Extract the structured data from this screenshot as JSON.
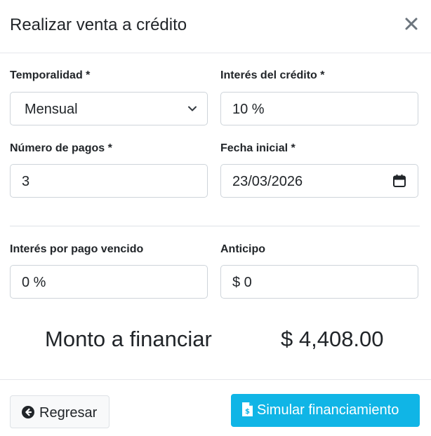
{
  "modal": {
    "title": "Realizar venta a crédito"
  },
  "form": {
    "temporalidad": {
      "label": "Temporalidad *",
      "value": "Mensual"
    },
    "interes_credito": {
      "label": "Interés del crédito *",
      "value": "10 %"
    },
    "numero_pagos": {
      "label": "Número de pagos *",
      "value": "3"
    },
    "fecha_inicial": {
      "label": "Fecha inicial *",
      "value": "23/03/2026"
    },
    "interes_vencido": {
      "label": "Interés por pago vencido",
      "value": "0 %"
    },
    "anticipo": {
      "label": "Anticipo",
      "value": "$ 0"
    }
  },
  "summary": {
    "label": "Monto a financiar",
    "value": "$ 4,408.00"
  },
  "footer": {
    "back_label": "Regresar",
    "simulate_label": "Simular financiamiento"
  },
  "colors": {
    "primary_info": "#10b5e6",
    "border": "#ced4da",
    "text": "#212529"
  },
  "icons": {
    "close": "close-icon",
    "back": "arrow-circle-left-icon",
    "simulate": "file-invoice-dollar-icon",
    "calendar": "calendar-icon",
    "select": "chevron-down-icon"
  }
}
